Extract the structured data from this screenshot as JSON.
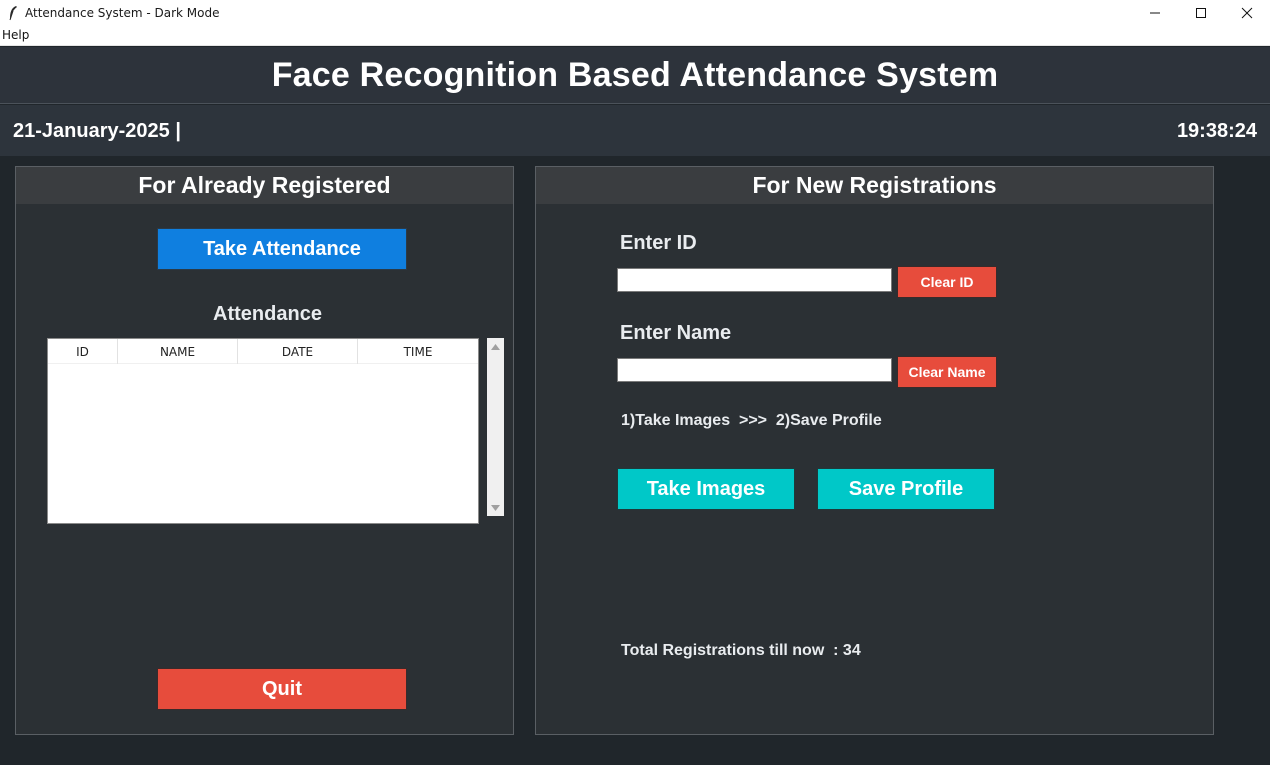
{
  "window": {
    "title": "Attendance System - Dark Mode",
    "minimize_glyph": "—",
    "maximize_glyph": "☐",
    "close_glyph": "✕"
  },
  "menu": {
    "help": "Help"
  },
  "header": {
    "title": "Face Recognition Based Attendance System"
  },
  "datebar": {
    "date": "21-January-2025  |",
    "time": "19:38:24"
  },
  "left_panel": {
    "title": "For Already Registered",
    "take_attendance": "Take Attendance",
    "attendance_label": "Attendance",
    "table_headers": [
      "ID",
      "NAME",
      "DATE",
      "TIME"
    ],
    "quit": "Quit"
  },
  "right_panel": {
    "title": "For New Registrations",
    "enter_id_label": "Enter ID",
    "id_value": "",
    "clear_id": "Clear ID",
    "enter_name_label": "Enter Name",
    "name_value": "",
    "clear_name": "Clear Name",
    "instructions": "1)Take Images  >>>  2)Save Profile",
    "take_images": "Take Images",
    "save_profile": "Save Profile",
    "total_registrations": "Total Registrations till now  : 34"
  },
  "colors": {
    "background": "#20262b",
    "header": "#2d333b",
    "panel": "#2b3034",
    "panel_header": "#3a3d40",
    "blue_button": "#0f7fe0",
    "red_button": "#e74c3c",
    "cyan_button": "#00c8c8"
  },
  "icons": {
    "app": "feather-icon",
    "minimize": "minimize-icon",
    "maximize": "maximize-icon",
    "close": "close-icon",
    "scroll_up": "scroll-up-arrow-icon",
    "scroll_down": "scroll-down-arrow-icon"
  }
}
